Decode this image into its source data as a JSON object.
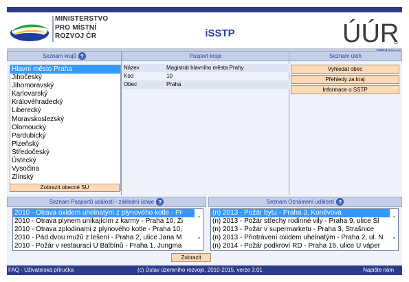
{
  "header": {
    "ministry_lines": [
      "MINISTERSTVO",
      "PRO MÍSTNÍ",
      "ROZVOJ ČR"
    ],
    "app_title": "iSSTP",
    "right_logo": "ÚÚR",
    "login_link": "Přihlášení"
  },
  "regions_panel": {
    "title": "Seznam krajů",
    "items": [
      "Hlavní město Praha",
      "Jihočeský",
      "Jihomoravský",
      "Karlovarský",
      "Královéhradecký",
      "Liberecký",
      "Moravskoslezský",
      "Olomoucký",
      "Pardubický",
      "Plzeňský",
      "Středočeský",
      "Ústecký",
      "Vysočina",
      "Zlínský"
    ],
    "selected_index": 0,
    "button_label": "Zobrazit obecné SÚ"
  },
  "pasport_panel": {
    "title": "Pasport kraje",
    "rows": [
      {
        "label": "Název",
        "value": "Magistrát hlavního města Prahy"
      },
      {
        "label": "Kód",
        "value": "10"
      },
      {
        "label": "Obec",
        "value": "Praha"
      }
    ]
  },
  "tasks_panel": {
    "title": "Seznam úloh",
    "buttons": [
      "Vyhledat obec",
      "Přehledy za kraj",
      "Informace o SSTP"
    ]
  },
  "events_panel": {
    "title": "Seznam Pasportů událostí - základní údaje",
    "items": [
      "2010 - Otrava oxidem uhelnatým z plynového kotle - Pr",
      "2010 - Otrava plynem unikajícím z karmy - Praha 10, Ži",
      "2010 - Otrava zplodinami z plynového kotle - Praha 10,",
      "2010 - Pád dvou mužů z lešení - Praha 2, ulice Jana M",
      "2010 - Požár v restauraci U Balbínů - Praha 1, Jungma"
    ],
    "selected_index": 0
  },
  "notices_panel": {
    "title": "Seznam Oznámení událostí",
    "items": [
      "(n) 2013 - Požár bytu - Praha 3, Koněvova",
      "(n) 2013 - Požár střechy rodinné vily - Praha 9, ulice Šl",
      "(n) 2013 - Požár v supermarketu - Praha 3, Strašnice",
      "(n) 2013 - Přiotrávení oxidem uhelnatým - Praha 2, ul. N",
      "(n) 2014 - Požár podkroví RD - Praha 16, ulice U váper"
    ],
    "selected_index": 0
  },
  "show_button": "Zobrazit",
  "footer": {
    "left": "FAQ - Uživatelská příručka",
    "middle": "(c) Ústav územního rozvoje, 2010-2015, verze 3.01",
    "right": "Napište nám"
  },
  "help_icon_glyph": "?",
  "colors": {
    "brand_bar": "#2e3b8c",
    "panel_header": "#c5d0e8",
    "selection": "#3399ff",
    "button_bg": "#fbd9b9",
    "title_blue": "#2e3fa3"
  }
}
